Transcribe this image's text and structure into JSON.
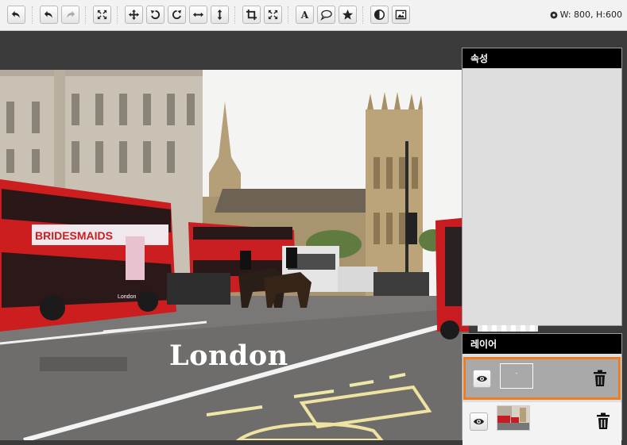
{
  "toolbar": {
    "buttons": [
      {
        "name": "reset-icon",
        "enabled": true
      },
      {
        "name": "undo-icon",
        "enabled": true
      },
      {
        "name": "redo-icon",
        "enabled": false
      },
      {
        "name": "fit-icon",
        "enabled": true
      },
      {
        "name": "move-icon",
        "enabled": true
      },
      {
        "name": "rotate-left-icon",
        "enabled": true
      },
      {
        "name": "rotate-right-icon",
        "enabled": true
      },
      {
        "name": "flip-horizontal-icon",
        "enabled": true
      },
      {
        "name": "flip-vertical-icon",
        "enabled": true
      },
      {
        "name": "crop-icon",
        "enabled": true
      },
      {
        "name": "resize-icon",
        "enabled": true
      },
      {
        "name": "text-icon",
        "enabled": true
      },
      {
        "name": "speech-bubble-icon",
        "enabled": true
      },
      {
        "name": "star-icon",
        "enabled": true
      },
      {
        "name": "contrast-icon",
        "enabled": true
      },
      {
        "name": "image-icon",
        "enabled": true
      }
    ],
    "dimensions": "W: 800, H:600"
  },
  "canvas": {
    "overlay_text": "London",
    "bus_sign": "BRIDESMAIDS",
    "bus_brand": "London"
  },
  "properties_panel": {
    "title": "속성"
  },
  "layers_panel": {
    "title": "레이어",
    "layers": [
      {
        "type": "text",
        "thumb_label": "-",
        "selected": true
      },
      {
        "type": "image",
        "selected": false
      }
    ]
  },
  "colors": {
    "accent": "#f07c22",
    "panel_header": "#000000",
    "workspace": "#3b3b3b"
  }
}
